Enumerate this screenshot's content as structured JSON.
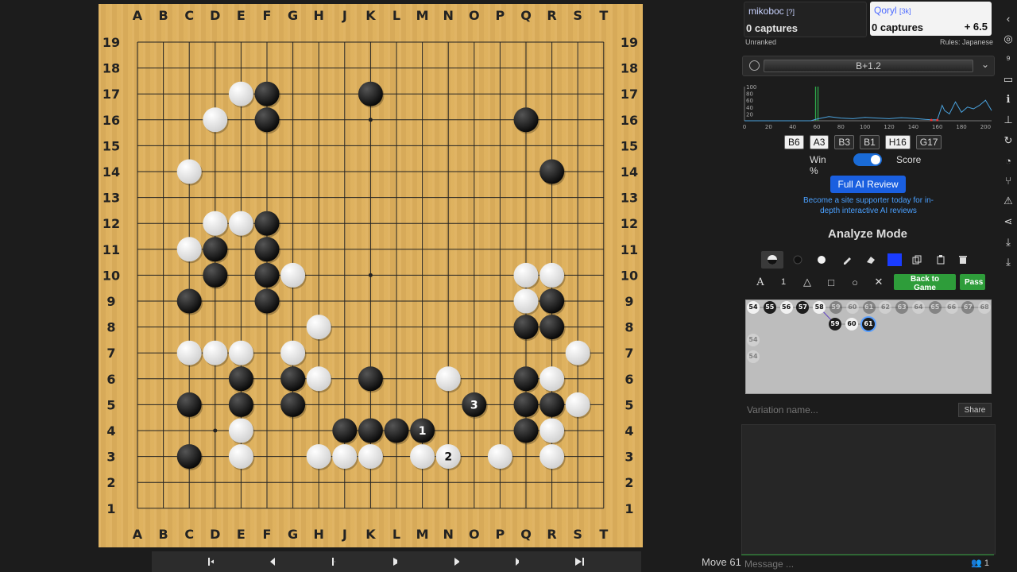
{
  "board": {
    "columns": [
      "A",
      "B",
      "C",
      "D",
      "E",
      "F",
      "G",
      "H",
      "J",
      "K",
      "L",
      "M",
      "N",
      "O",
      "P",
      "Q",
      "R",
      "S",
      "T"
    ],
    "rows": [
      "19",
      "18",
      "17",
      "16",
      "15",
      "14",
      "13",
      "12",
      "11",
      "10",
      "9",
      "8",
      "7",
      "6",
      "5",
      "4",
      "3",
      "2",
      "1"
    ],
    "star_points": [
      "D4",
      "K10",
      "K16"
    ],
    "black_stones": [
      "F17",
      "K17",
      "F16",
      "Q16",
      "R14",
      "F12",
      "D11",
      "F11",
      "D10",
      "F10",
      "C9",
      "F9",
      "R9",
      "Q8",
      "R8",
      "E6",
      "G6",
      "K6",
      "Q6",
      "C5",
      "E5",
      "G5",
      "Q5",
      "R5",
      "J4",
      "K4",
      "L4",
      "Q4",
      "C3"
    ],
    "white_stones": [
      "E17",
      "D16",
      "C14",
      "D12",
      "E12",
      "C11",
      "G10",
      "Q10",
      "R10",
      "Q9",
      "H8",
      "C7",
      "D7",
      "E7",
      "G7",
      "S7",
      "H6",
      "N6",
      "R6",
      "S5",
      "E4",
      "R4",
      "E3",
      "H3",
      "J3",
      "K3",
      "M3",
      "P3",
      "R3"
    ],
    "numbered_moves": [
      {
        "point": "M4",
        "color": "black",
        "label": "1"
      },
      {
        "point": "N3",
        "color": "white",
        "label": "2"
      },
      {
        "point": "O5",
        "color": "black",
        "label": "3"
      }
    ]
  },
  "controls": {
    "icons": [
      "first-icon",
      "back-ten-icon",
      "back-icon",
      "play-icon",
      "forward-icon",
      "forward-ten-icon",
      "last-icon"
    ]
  },
  "move_count": "Move 61",
  "players": {
    "black": {
      "name": "mikoboc",
      "rank": "[?]",
      "captures": "0 captures",
      "note": "Unranked"
    },
    "white": {
      "name": "Qoryl",
      "rank": "[3k]",
      "captures": "0 captures",
      "komi": "+ 6.5",
      "note": "Rules: Japanese"
    }
  },
  "eval": {
    "score": "B+1.2",
    "caret": "⌄"
  },
  "winrate_chart": {
    "y_ticks": [
      "100",
      "80",
      "60",
      "40",
      "20"
    ],
    "x_ticks": [
      "0",
      "20",
      "40",
      "60",
      "80",
      "100",
      "120",
      "140",
      "160",
      "180",
      "200"
    ],
    "xlim": [
      0,
      205
    ],
    "ylim": [
      0,
      100
    ],
    "line_color": "#4aa3df",
    "series": [
      {
        "x": [
          0,
          20,
          40,
          55,
          60,
          70,
          80,
          90,
          100,
          110,
          120,
          130,
          140,
          150,
          155,
          160,
          164,
          166,
          170,
          175,
          180,
          185,
          190,
          195,
          200,
          205
        ],
        "y": [
          0,
          0,
          0,
          0,
          5,
          12,
          8,
          6,
          10,
          8,
          6,
          9,
          7,
          4,
          3,
          3,
          45,
          30,
          20,
          55,
          25,
          40,
          35,
          45,
          60,
          30
        ]
      }
    ],
    "markers": [
      {
        "x": 59,
        "color": "#2fa84a"
      },
      {
        "x": 61,
        "color": "#2fa84a"
      }
    ],
    "red_points": [
      {
        "x": 155,
        "y": 2
      },
      {
        "x": 160,
        "y": 2
      }
    ]
  },
  "ai_moves": [
    {
      "label": "B6",
      "style": "light"
    },
    {
      "label": "A3",
      "style": "light"
    },
    {
      "label": "B3",
      "style": "dark"
    },
    {
      "label": "B1",
      "style": "dark"
    },
    {
      "label": "H16",
      "style": "light"
    },
    {
      "label": "G17",
      "style": "dark"
    }
  ],
  "toggle": {
    "left_label": "Win %",
    "right_label": "Score",
    "on": true
  },
  "review_button": "Full AI Review",
  "support_text": "Become a site supporter today for in-depth interactive AI reviews",
  "mode_title": "Analyze Mode",
  "tools_row2": {
    "letter": "A",
    "number": "1",
    "triangle": "△",
    "square": "□",
    "circle": "○",
    "cross": "✕"
  },
  "back_to_game": "Back to Game",
  "pass": "Pass",
  "tree": {
    "main": [
      {
        "n": "54",
        "c": "w"
      },
      {
        "n": "55",
        "c": "b"
      },
      {
        "n": "56",
        "c": "w"
      },
      {
        "n": "57",
        "c": "b"
      },
      {
        "n": "58",
        "c": "w"
      },
      {
        "n": "59",
        "c": "b",
        "faded": true
      },
      {
        "n": "60",
        "c": "w",
        "faded": true
      },
      {
        "n": "61",
        "c": "b",
        "faded": true
      },
      {
        "n": "62",
        "c": "w",
        "faded": true
      },
      {
        "n": "63",
        "c": "b",
        "faded": true
      },
      {
        "n": "64",
        "c": "w",
        "faded": true
      },
      {
        "n": "65",
        "c": "b",
        "faded": true
      },
      {
        "n": "66",
        "c": "w",
        "faded": true
      },
      {
        "n": "67",
        "c": "b",
        "faded": true
      },
      {
        "n": "68",
        "c": "w",
        "faded": true
      }
    ],
    "branch": [
      {
        "n": "59",
        "c": "b"
      },
      {
        "n": "60",
        "c": "w"
      },
      {
        "n": "61",
        "c": "b",
        "sel": true
      }
    ],
    "side": [
      {
        "n": "54",
        "c": "w",
        "faded": true
      },
      {
        "n": "54",
        "c": "w",
        "faded": true
      }
    ]
  },
  "variation_placeholder": "Variation name...",
  "share": "Share",
  "chat_placeholder": "Message ...",
  "users": "1",
  "sidebar_icons": [
    "chevron-left-icon",
    "zen-mode-icon",
    "move-numbers-icon",
    "monitor-icon",
    "info-icon",
    "tree-icon",
    "refresh-icon",
    "dashboard-icon",
    "branch-icon",
    "warning-icon",
    "share-icon",
    "download-icon",
    "download-sgf-icon"
  ]
}
